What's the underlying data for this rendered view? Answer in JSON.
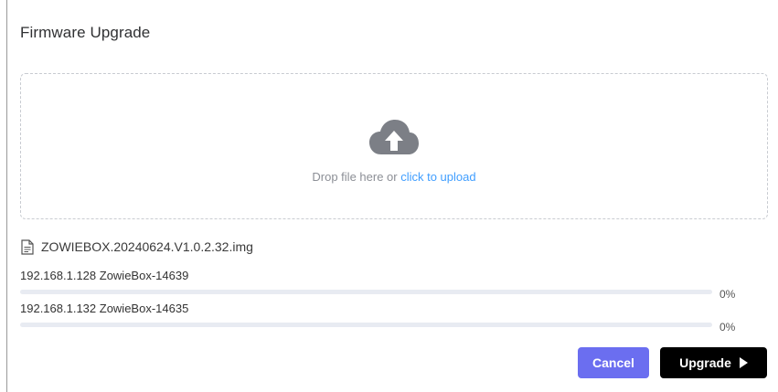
{
  "dialog": {
    "title": "Firmware Upgrade"
  },
  "dropzone": {
    "icon": "cloud-upload-icon",
    "text_prefix": "Drop file here or ",
    "link_text": "click to upload"
  },
  "file": {
    "icon": "document-icon",
    "name": "ZOWIEBOX.20240624.V1.0.2.32.img"
  },
  "devices": [
    {
      "label": "192.168.1.128 ZowieBox-14639",
      "progress": 0,
      "progress_text": "0%"
    },
    {
      "label": "192.168.1.132 ZowieBox-14635",
      "progress": 0,
      "progress_text": "0%"
    }
  ],
  "buttons": {
    "cancel_label": "Cancel",
    "upgrade_label": "Upgrade",
    "upgrade_icon": "play-icon"
  },
  "colors": {
    "link": "#409eff",
    "cancel_bg": "#6b6ef0",
    "upgrade_bg": "#000000"
  }
}
